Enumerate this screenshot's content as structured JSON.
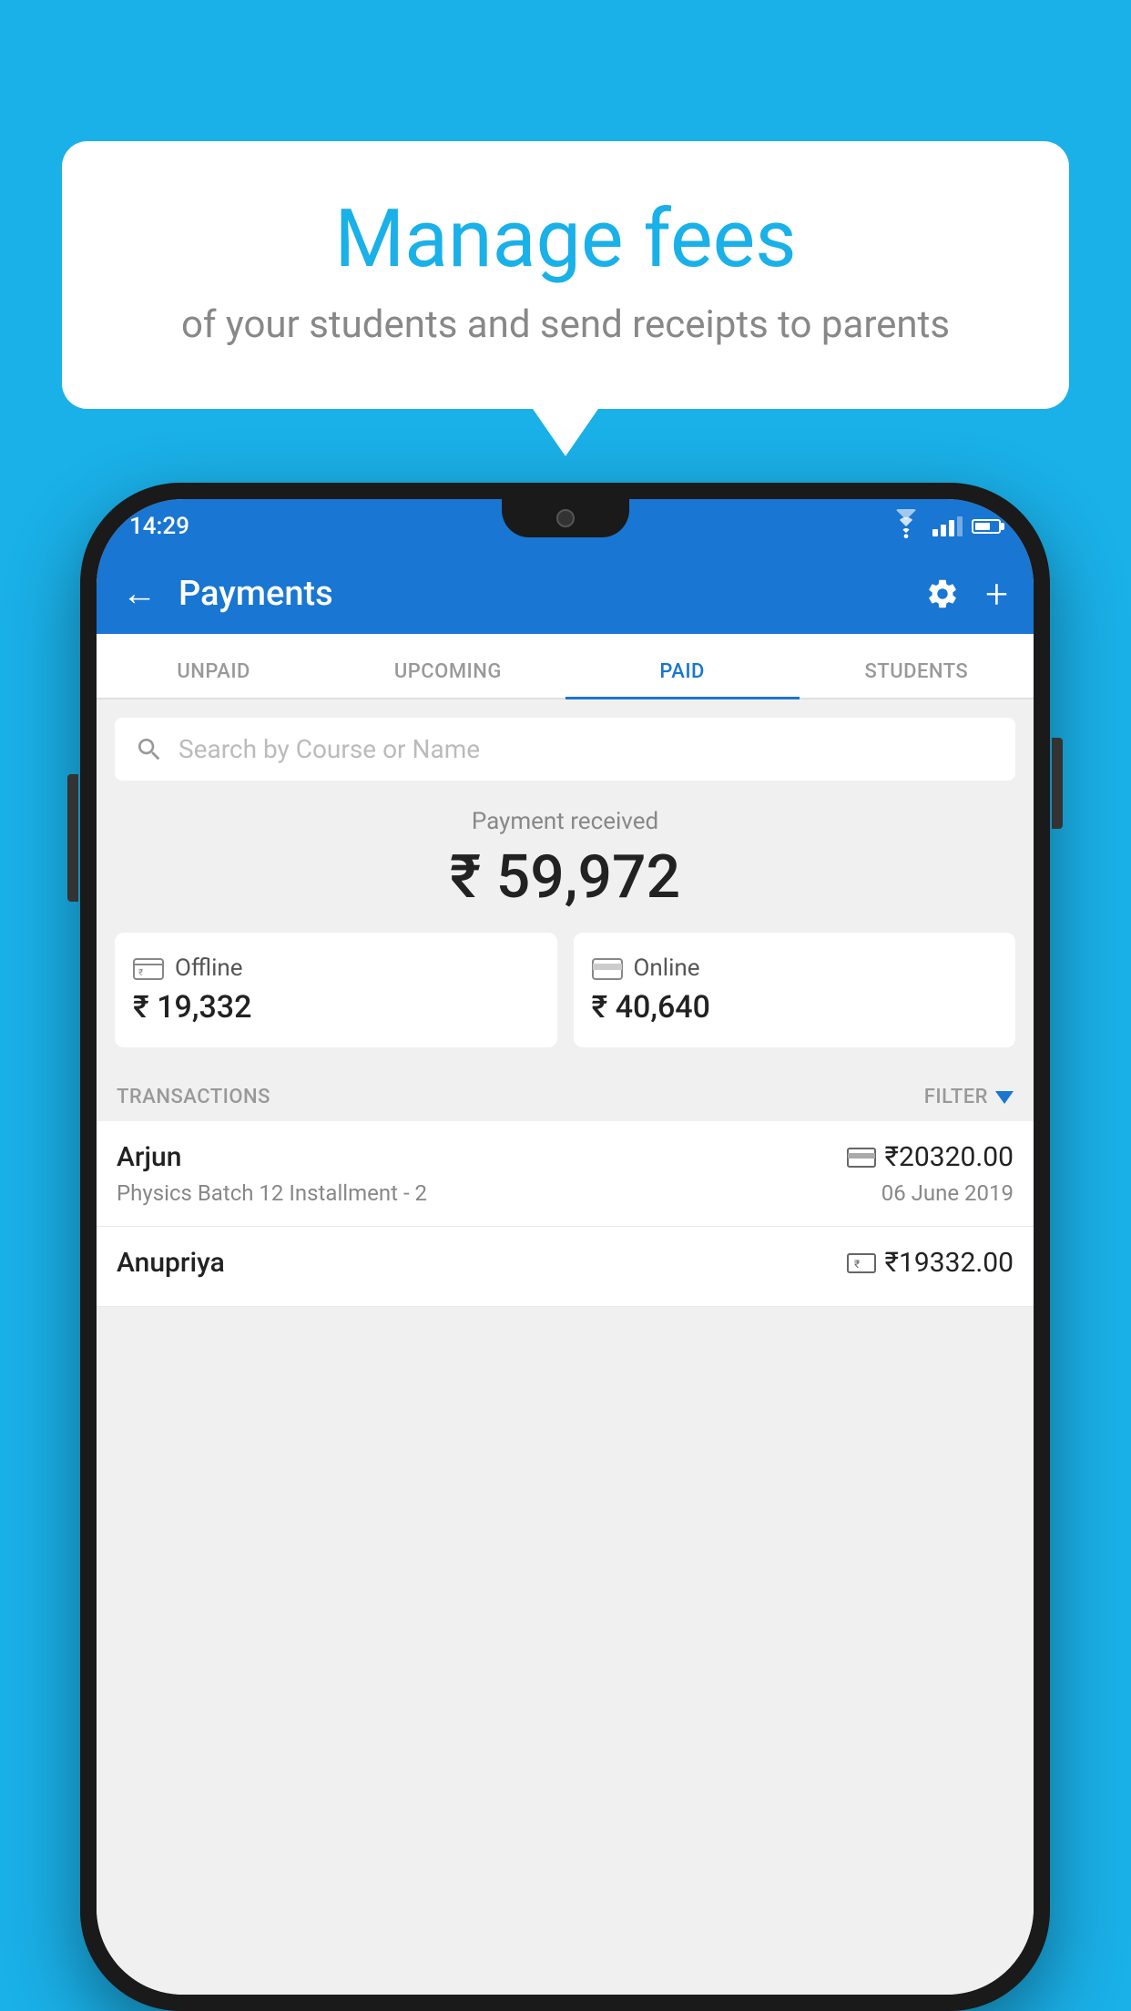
{
  "background_color": "#1ab0e8",
  "bubble": {
    "title": "Manage fees",
    "subtitle": "of your students and send receipts to parents"
  },
  "status_bar": {
    "time": "14:29"
  },
  "app_bar": {
    "title": "Payments",
    "back_label": "←",
    "plus_label": "+"
  },
  "tabs": [
    {
      "label": "UNPAID",
      "active": false
    },
    {
      "label": "UPCOMING",
      "active": false
    },
    {
      "label": "PAID",
      "active": true
    },
    {
      "label": "STUDENTS",
      "active": false
    }
  ],
  "search": {
    "placeholder": "Search by Course or Name"
  },
  "payment_summary": {
    "label": "Payment received",
    "total": "₹ 59,972",
    "offline_label": "Offline",
    "offline_amount": "₹ 19,332",
    "online_label": "Online",
    "online_amount": "₹ 40,640"
  },
  "transactions_section": {
    "label": "TRANSACTIONS",
    "filter_label": "FILTER"
  },
  "transactions": [
    {
      "name": "Arjun",
      "course": "Physics Batch 12 Installment - 2",
      "amount": "₹20320.00",
      "date": "06 June 2019",
      "payment_type": "online"
    },
    {
      "name": "Anupriya",
      "course": "",
      "amount": "₹19332.00",
      "date": "",
      "payment_type": "offline"
    }
  ]
}
